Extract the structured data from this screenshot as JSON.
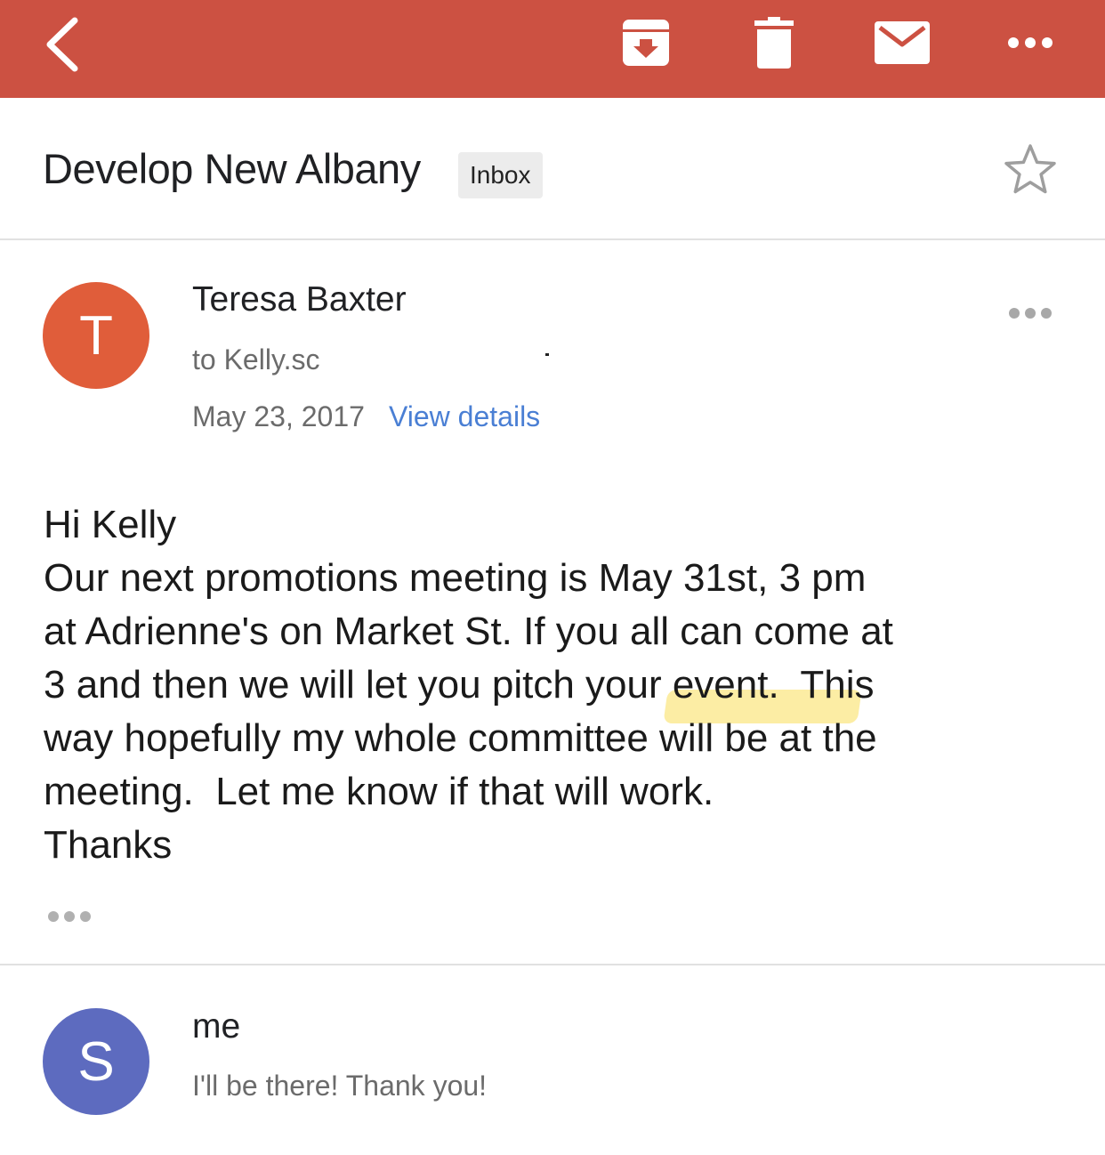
{
  "toolbar": {
    "color": "#cc5142",
    "icons": [
      "back-arrow-icon",
      "archive-icon",
      "trash-icon",
      "mail-icon",
      "more-horizontal-icon"
    ]
  },
  "subject": {
    "title": "Develop New Albany",
    "label": "Inbox",
    "star_icon": "star-outline-icon"
  },
  "messages": [
    {
      "avatar_letter": "T",
      "avatar_color": "#e05d3a",
      "sender": "Teresa Baxter",
      "recipient": "to Kelly.sc",
      "date": "May 23, 2017",
      "view_details": "View details",
      "body_lines": [
        "Hi Kelly",
        "Our next promotions meeting is May 31st, 3 pm",
        "at Adrienne's on Market St. If you all can come at",
        "3 and then we will let you pitch your event.  This",
        "way hopefully my whole committee will be at the",
        "meeting.  Let me know if that will work.",
        "Thanks"
      ],
      "highlight_color": "#fade5a"
    },
    {
      "avatar_letter": "S",
      "avatar_color": "#5d6bbf",
      "sender": "me",
      "snippet": "I'll be there! Thank you!"
    }
  ]
}
